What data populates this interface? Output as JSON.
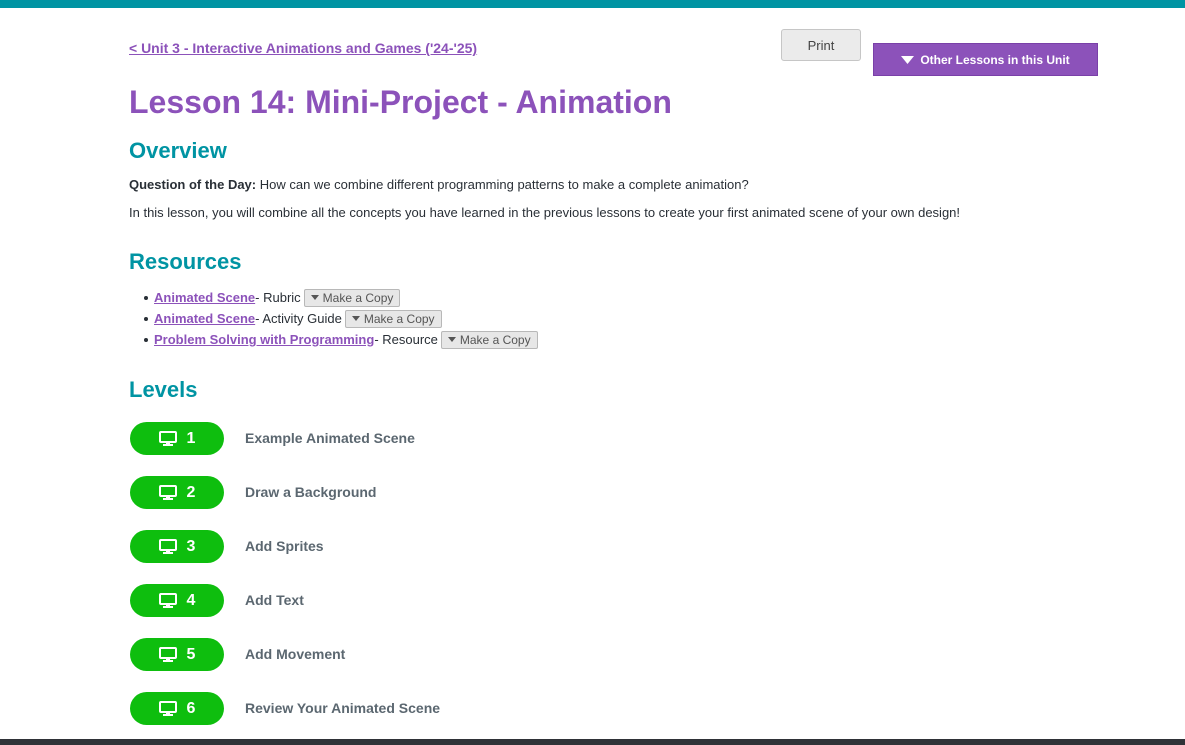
{
  "header": {
    "back_link": "< Unit 3 - Interactive Animations and Games ('24-'25)",
    "print_label": "Print",
    "other_lessons_label": "Other Lessons in this Unit"
  },
  "lesson": {
    "title": "Lesson 14: Mini-Project - Animation"
  },
  "overview": {
    "heading": "Overview",
    "qotd_label": "Question of the Day:",
    "qotd_text": " How can we combine different programming patterns to make a complete animation?",
    "description": "In this lesson, you will combine all the concepts you have learned in the previous lessons to create your first animated scene of your own design!"
  },
  "resources": {
    "heading": "Resources",
    "make_copy_label": "Make a Copy",
    "items": [
      {
        "link": "Animated Scene",
        "type": " - Rubric"
      },
      {
        "link": "Animated Scene",
        "type": " - Activity Guide"
      },
      {
        "link": "Problem Solving with Programming",
        "type": " - Resource"
      }
    ]
  },
  "levels": {
    "heading": "Levels",
    "items": [
      {
        "number": "1",
        "label": "Example Animated Scene"
      },
      {
        "number": "2",
        "label": "Draw a Background"
      },
      {
        "number": "3",
        "label": "Add Sprites"
      },
      {
        "number": "4",
        "label": "Add Text"
      },
      {
        "number": "5",
        "label": "Add Movement"
      },
      {
        "number": "6",
        "label": "Review Your Animated Scene"
      }
    ]
  },
  "colors": {
    "accent_purple": "#8c52ba",
    "teal": "#0094a3",
    "level_green": "#0ebe0e"
  },
  "icons": {
    "level_icon": "desktop-icon",
    "dropdown_icon": "caret-down-icon"
  }
}
